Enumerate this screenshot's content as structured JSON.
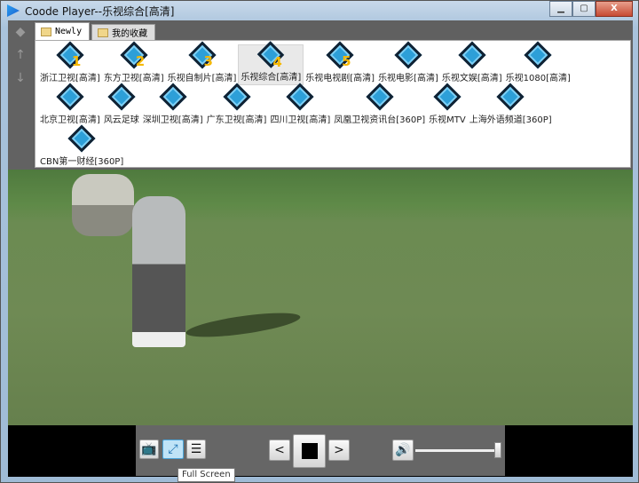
{
  "window": {
    "title": "Coode Player--乐视综合[高清]",
    "minimize": "▁",
    "maximize": "▢",
    "close": "X"
  },
  "tabs": [
    {
      "label": "Newly",
      "active": true
    },
    {
      "label": "我的收藏",
      "active": false
    }
  ],
  "channels": [
    [
      {
        "label": "浙江卫视[高清]",
        "num": "1"
      },
      {
        "label": "东方卫视[高清]",
        "num": "2"
      },
      {
        "label": "乐视自制片[高清]",
        "num": "3"
      },
      {
        "label": "乐视综合[高清]",
        "num": "4",
        "selected": true
      },
      {
        "label": "乐视电视剧[高清]",
        "num": "5"
      },
      {
        "label": "乐视电影[高清]"
      },
      {
        "label": "乐视文娱[高清]"
      },
      {
        "label": "乐视1080[高清]"
      }
    ],
    [
      {
        "label": "北京卫视[高清]"
      },
      {
        "label": "风云足球"
      },
      {
        "label": "深圳卫视[高清]"
      },
      {
        "label": "广东卫视[高清]"
      },
      {
        "label": "四川卫视[高清]"
      },
      {
        "label": "凤凰卫视资讯台[360P]"
      },
      {
        "label": "乐视MTV"
      },
      {
        "label": "上海外语频道[360P]"
      }
    ],
    [
      {
        "label": "CBN第一财经[360P]"
      }
    ]
  ],
  "controls": {
    "prev": "<",
    "next": ">",
    "tooltip": "Full Screen",
    "volume_percent": 100
  }
}
